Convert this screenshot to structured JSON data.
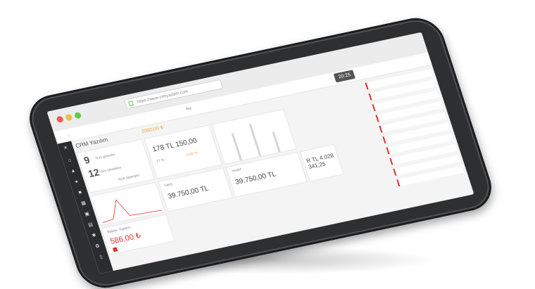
{
  "browser": {
    "url": "https://www.crmyazilim.com"
  },
  "topbar": {
    "clock": "20:25",
    "profile_name": "",
    "nav_back": "‹",
    "nav_forward": "›",
    "search_placeholder": "Ara"
  },
  "main": {
    "title": "CRM Yazılım",
    "amount_badge": "2000,00 ₺",
    "stats": [
      {
        "value": "9",
        "label": "Yeni görevler"
      },
      {
        "value": "12",
        "label": "Yeni etkinlikler"
      }
    ],
    "open_orders_label": "Açık siparişler",
    "mid_value": "178 TL 150,00",
    "percent_a": "17 %",
    "percent_b": "0,00 %",
    "sales_card": {
      "label": "Satış",
      "value": "39.750,00 TL"
    },
    "sales_card2": {
      "label": "Hedef",
      "value": "39.750,00 TL"
    },
    "right_value": "R TL 4.028 341,25",
    "bottom_red_value": "586,00 ₺",
    "bottom_red_label": "Bakiye Toplamı"
  },
  "sidebar": {
    "icons": [
      "close-icon",
      "home-icon",
      "chart-icon",
      "user-icon",
      "folder-icon",
      "calendar-icon",
      "box-icon",
      "document-icon",
      "gear-icon",
      "settings-icon",
      "file-icon"
    ]
  },
  "colors": {
    "accent": "#e0302c",
    "highlight": "#f0a431",
    "sidebar": "#2b2c2e",
    "bezel": "#2e2f31"
  }
}
